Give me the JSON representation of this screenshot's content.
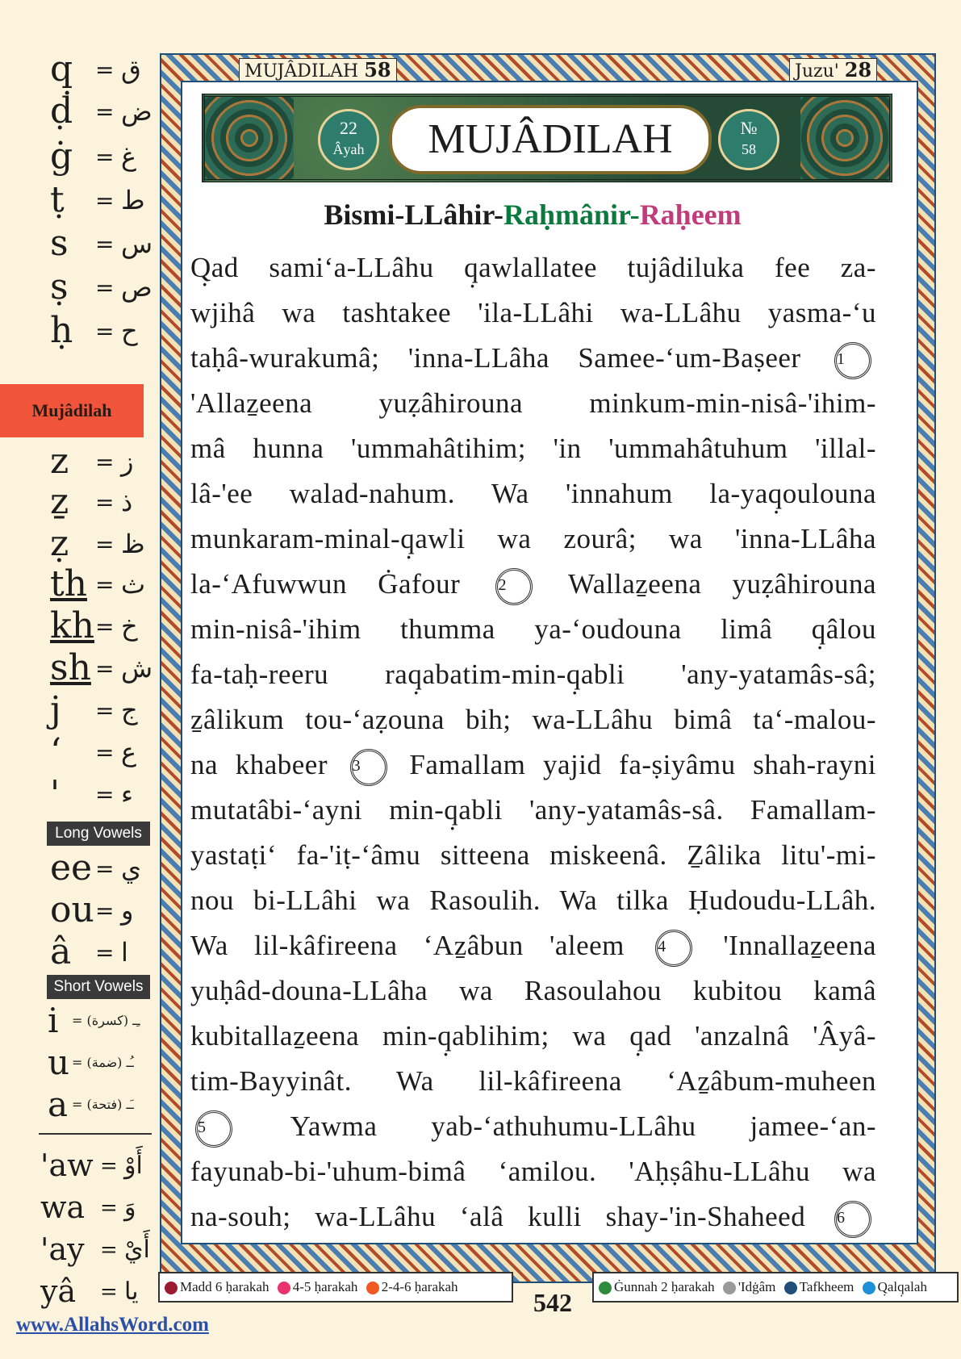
{
  "header": {
    "surah_label": "MUJÂDILAH",
    "surah_number": "58",
    "juzu_label": "Juzu'",
    "juzu_number": "28"
  },
  "banner": {
    "title": "MUJÂDILAH",
    "ayah_count": "22",
    "ayah_word": "Âyah",
    "number_prefix": "№",
    "number": "58"
  },
  "side_tab": "Mujâdilah",
  "consonants_top": [
    {
      "latin": "q̣",
      "arabic": "ق"
    },
    {
      "latin": "ḍ",
      "arabic": "ض"
    },
    {
      "latin": "ġ",
      "arabic": "غ"
    },
    {
      "latin": "ṭ",
      "arabic": "ط"
    },
    {
      "latin": "s",
      "arabic": "س"
    },
    {
      "latin": "ṣ",
      "arabic": "ص"
    },
    {
      "latin": "ḥ",
      "arabic": "ح"
    }
  ],
  "consonants_bottom": [
    {
      "latin": "z",
      "arabic": "ز"
    },
    {
      "latin": "ẕ",
      "arabic": "ذ"
    },
    {
      "latin": "ẓ",
      "arabic": "ظ"
    },
    {
      "latin": "th",
      "arabic": "ث"
    },
    {
      "latin": "kh",
      "arabic": "خ"
    },
    {
      "latin": "sh",
      "arabic": "ش"
    },
    {
      "latin": "j",
      "arabic": "ج"
    },
    {
      "latin": "ʻ",
      "arabic": "ع"
    },
    {
      "latin": "'",
      "arabic": "ء"
    }
  ],
  "long_vowels_label": "Long Vowels",
  "long_vowels": [
    {
      "latin": "ee",
      "arabic": "ي"
    },
    {
      "latin": "ou",
      "arabic": "و"
    },
    {
      "latin": "â",
      "arabic": "ا"
    }
  ],
  "short_vowels_label": "Short Vowels",
  "short_vowels": [
    {
      "latin": "i",
      "mark": "= ـِـ (كسرة)"
    },
    {
      "latin": "u",
      "mark": "= ـُـ (ضمة)"
    },
    {
      "latin": "a",
      "mark": "= ـَـ (فتحة)"
    }
  ],
  "combos": [
    {
      "latin": "'aw",
      "arabic": "أَوْ"
    },
    {
      "latin": "wa",
      "arabic": "وَ"
    },
    {
      "latin": "'ay",
      "arabic": "أَيْ"
    },
    {
      "latin": "yâ",
      "arabic": "يا"
    }
  ],
  "basmala": [
    "Bismi-LLâhir-",
    "Raḥmânir-",
    "Raḥeem"
  ],
  "verse_lines": [
    "Q̣ad samiʻa-LLâhu q̣awlallatee tujâdiluka fee za-",
    "wjihâ wa tashtakee 'ila-LLâhi wa-LLâhu yasma-ʻu",
    "taḥâ-wurakumâ; 'inna-LLâha Samee-ʻum-Baṣeer",
    "'Allaẕeena yuẓâhirouna minkum-min-nisâ-'ihim-",
    "mâ hunna 'ummahâtihim; 'in 'ummahâtuhum 'illal-",
    "lâ-'ee walad-nahum. Wa 'innahum la-yaq̣oulouna",
    "munkaram-minal-q̣awli wa zourâ; wa 'inna-LLâha",
    "la-ʻAfuwwun Ġafour",
    "min-nisâ-'ihim thumma ya-ʻoudouna limâ q̣âlou",
    "fa-taḥ-reeru raq̣abatim-min-q̣abli 'any-yatamâs-sâ;",
    "ẕâlikum tou-ʻaẓouna bih; wa-LLâhu bimâ taʻ-malou-",
    "na khabeer",
    "mutatâbi-ʻayni min-q̣abli 'any-yatamâs-sâ. Famallam-",
    "yastaṭiʻ fa-'iṭ-ʻâmu sitteena miskeenâ. Ẕâlika litu'-mi-",
    "nou bi-LLâhi wa Rasoulih. Wa tilka Ḥudoudu-LLâh.",
    "Wa lil-kâfireena ʻAẕâbun 'aleem",
    "yuḥâd-douna-LLâha wa Rasoulahou kubitou kamâ",
    "kubitallaẕeena min-q̣ablihim; wa q̣ad 'anzalnâ 'Âyâ-",
    "tim-Bayyinât. Wa lil-kâfireena ʻAẕâbum-muheen",
    "Yawma yab-ʻathuhumu-LLâhu jamee-ʻan-",
    "fayunab-bi-'uhum-bimâ ʻamilou. 'Aḥṣâhu-LLâhu wa",
    "na-souh; wa-LLâhu ʻalâ kulli shay-'in-Shaheed"
  ],
  "verse_continuations": {
    "line8_after": "Wallaẕeena yuẓâhirouna",
    "line12_after": "Famallam yajid fa-ṣiyâmu shah-rayni",
    "line16_after": "'Innallaẕeena"
  },
  "ayah_markers": [
    "1",
    "2",
    "3",
    "4",
    "5",
    "6"
  ],
  "legend_left": [
    {
      "color": "#9b1b30",
      "label": "Madd 6 ḥarakah"
    },
    {
      "color": "#e8336d",
      "label": "4-5 ḥarakah"
    },
    {
      "color": "#f05a22",
      "label": "2-4-6 ḥarakah"
    }
  ],
  "legend_right": [
    {
      "color": "#2f8a3c",
      "label": "Ġunnah 2 ḥarakah"
    },
    {
      "color": "#9a9a9a",
      "label": "'Idġâm"
    },
    {
      "color": "#1f4e79",
      "label": "Tafkheem"
    },
    {
      "color": "#1d8fd6",
      "label": "Q̣alq̣alah"
    }
  ],
  "page_number": "542",
  "website": "www.AllahsWord.com"
}
